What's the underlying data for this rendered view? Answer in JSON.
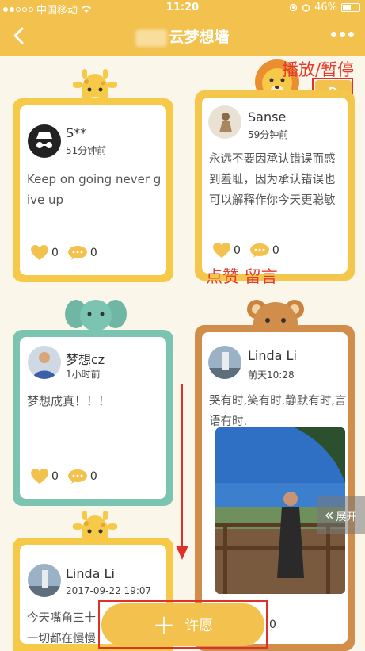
{
  "status_bar": {
    "carrier": "中国移动",
    "time": "11:20",
    "battery": "46%"
  },
  "nav": {
    "title": "云梦想墙"
  },
  "cards": [
    {
      "user": "S**",
      "time": "51分钟前",
      "text": "Keep on going never give up",
      "likes": "0",
      "comments": "0"
    },
    {
      "user": "Sanse",
      "time": "59分钟前",
      "text": "永远不要因承认错误而感到羞耻，因为承认错误也可以解释作你今天更聪敏",
      "likes": "0",
      "comments": "0"
    },
    {
      "user": "梦想cz",
      "time": "1小时前",
      "text": "梦想成真！！！",
      "likes": "0",
      "comments": "0"
    },
    {
      "user": "Linda Li",
      "time": "前天10:28",
      "text": "哭有时,笑有时.静默有时,言语有时.",
      "likes": "",
      "comments": "0"
    },
    {
      "user": "Linda Li",
      "time": "2017-09-22 19:07",
      "text": "今天嘴角三十 一切都在慢慢"
    }
  ],
  "annotations": {
    "play_pause": "播放/暂停",
    "like_comment": "点赞 留言"
  },
  "expand_label": "展开",
  "wish_label": "许愿",
  "colors": {
    "primary": "#f2c14e",
    "background": "#fbf6ea",
    "annotation": "#e23b2e"
  }
}
